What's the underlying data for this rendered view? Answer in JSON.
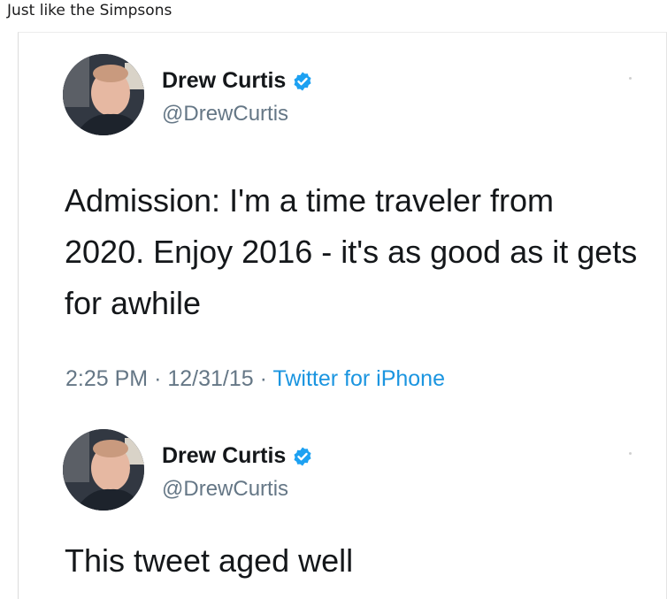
{
  "post": {
    "title": "Just like the Simpsons"
  },
  "tweets": [
    {
      "author": {
        "name": "Drew Curtis",
        "handle": "@DrewCurtis"
      },
      "text": "Admission: I'm a time traveler from 2020. Enjoy 2016 - it's as good as it gets for awhile",
      "meta": {
        "time": "2:25 PM",
        "separator": "·",
        "date": "12/31/15",
        "source": "Twitter for iPhone"
      }
    },
    {
      "author": {
        "name": "Drew Curtis",
        "handle": "@DrewCurtis"
      },
      "text": "This tweet aged well"
    }
  ],
  "colors": {
    "name": "#14171a",
    "handle": "#657786",
    "source": "#1b95e0",
    "verified": "#1da1f2"
  },
  "icons": {
    "verified": "verified-badge-icon"
  }
}
